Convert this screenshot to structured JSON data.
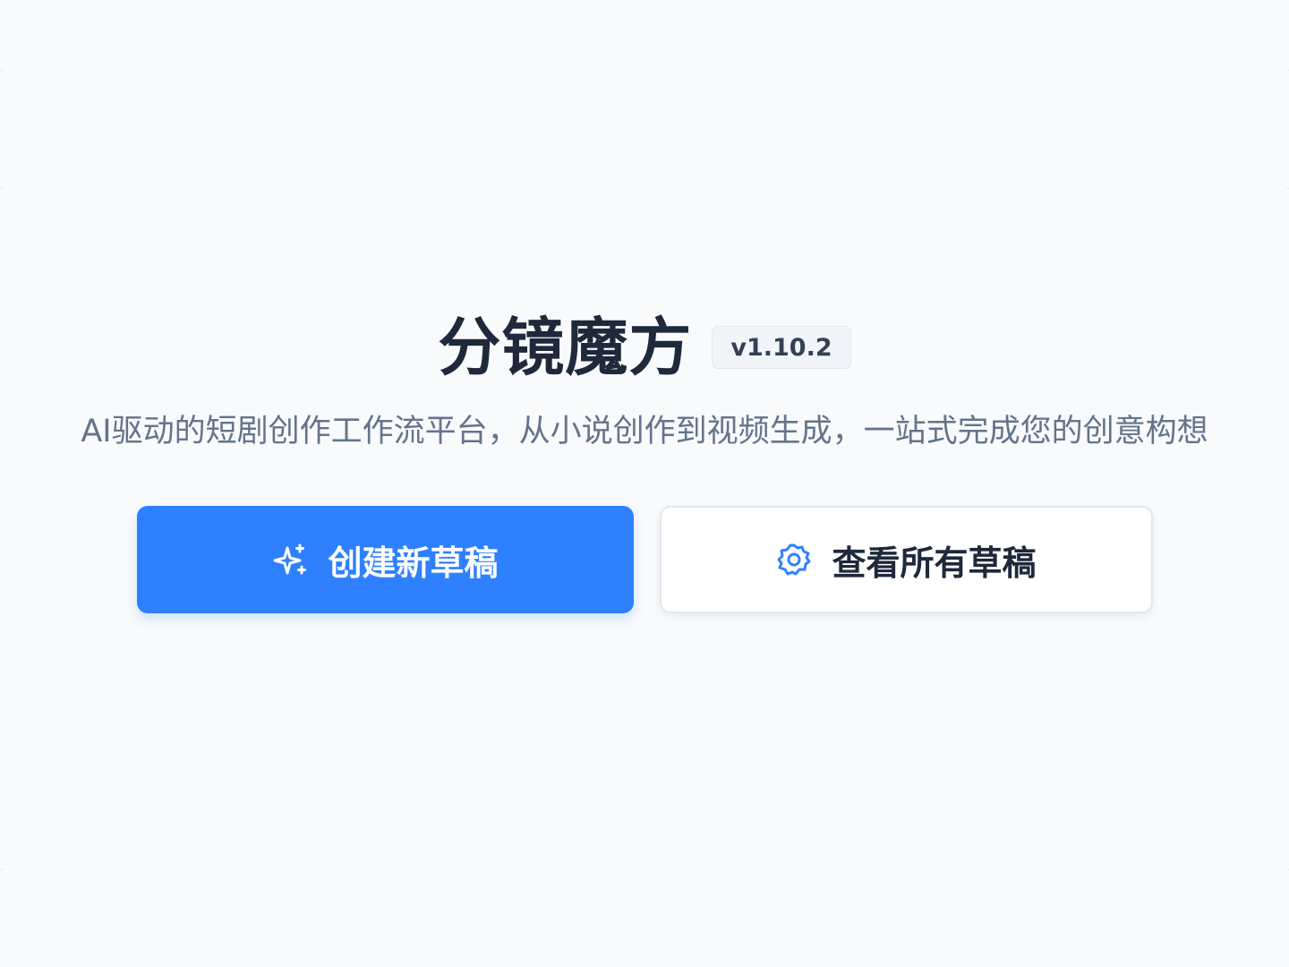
{
  "app": {
    "title": "分镜魔方",
    "version": "v1.10.2",
    "subtitle": "AI驱动的短剧创作工作流平台，从小说创作到视频生成，一站式完成您的创意构想"
  },
  "actions": {
    "create": {
      "label": "创建新草稿",
      "icon": "sparkles-icon"
    },
    "view_all": {
      "label": "查看所有草稿",
      "icon": "gear-icon"
    }
  },
  "colors": {
    "background": "#f8fafc",
    "primary": "#2f80ff",
    "title": "#1e293b",
    "subtitle": "#64748b",
    "border": "#e2e8f0"
  }
}
